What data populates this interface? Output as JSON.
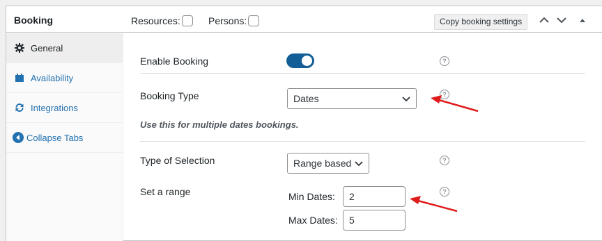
{
  "header": {
    "title": "Booking",
    "resources_label": "Resources:",
    "persons_label": "Persons:",
    "copy_button": "Copy booking settings"
  },
  "sidebar": {
    "items": [
      {
        "label": "General",
        "icon": "gear-icon"
      },
      {
        "label": "Availability",
        "icon": "calendar-icon"
      },
      {
        "label": "Integrations",
        "icon": "sync-icon"
      },
      {
        "label": "Collapse Tabs",
        "icon": "collapse-left-icon"
      }
    ]
  },
  "main": {
    "enable_booking_label": "Enable Booking",
    "enable_booking_on": true,
    "booking_type_label": "Booking Type",
    "booking_type_value": "Dates",
    "booking_type_note": "Use this for multiple dates bookings.",
    "selection_type_label": "Type of Selection",
    "selection_type_value": "Range based",
    "range_label": "Set a range",
    "min_dates_label": "Min Dates:",
    "min_dates_value": "2",
    "max_dates_label": "Max Dates:",
    "max_dates_value": "5",
    "help_glyph": "?"
  },
  "colors": {
    "accent": "#2271b1",
    "toggle_on": "#135e96",
    "annotation_arrow": "#e01b1b"
  }
}
